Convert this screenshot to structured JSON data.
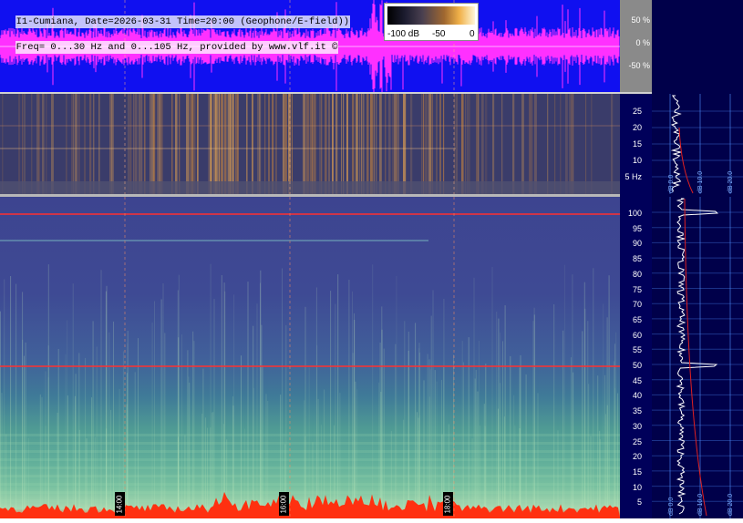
{
  "header": {
    "line1": "I1-Cumiana, Date=2026-03-31 Time=20:00 (Geophone/E-field))",
    "line2": "Freq= 0...30 Hz and 0...105 Hz, provided by www.vlf.it ©"
  },
  "colorbar": {
    "label_min": "-100 dB",
    "label_mid": "-50",
    "label_max": "0"
  },
  "waveform_axis": {
    "ticks": [
      "50 %",
      "0 %",
      "-50 %"
    ]
  },
  "geophone_axis": {
    "ticks": [
      "25",
      "20",
      "15",
      "10",
      "5 Hz"
    ]
  },
  "efield_axis": {
    "ticks": [
      "100",
      "95",
      "90",
      "85",
      "80",
      "75",
      "70",
      "65",
      "60",
      "55",
      "50",
      "45",
      "40",
      "35",
      "30",
      "25",
      "20",
      "15",
      "10",
      "5"
    ]
  },
  "time_labels": [
    "14:00",
    "16:00",
    "18:00"
  ],
  "profile_labels": {
    "upper": [
      "dB 0.0",
      "dB 10.0",
      "dB 20.0"
    ],
    "lower": [
      "dB 0.0",
      "dB 10.0",
      "dB 20.0"
    ]
  },
  "colors": {
    "waveform_bg": "#1010f0",
    "waveform_trace": "#ff30ff",
    "hum_line": "#ff3030",
    "axis_bg": "#00005a",
    "profile_bg": "#00004a"
  }
}
